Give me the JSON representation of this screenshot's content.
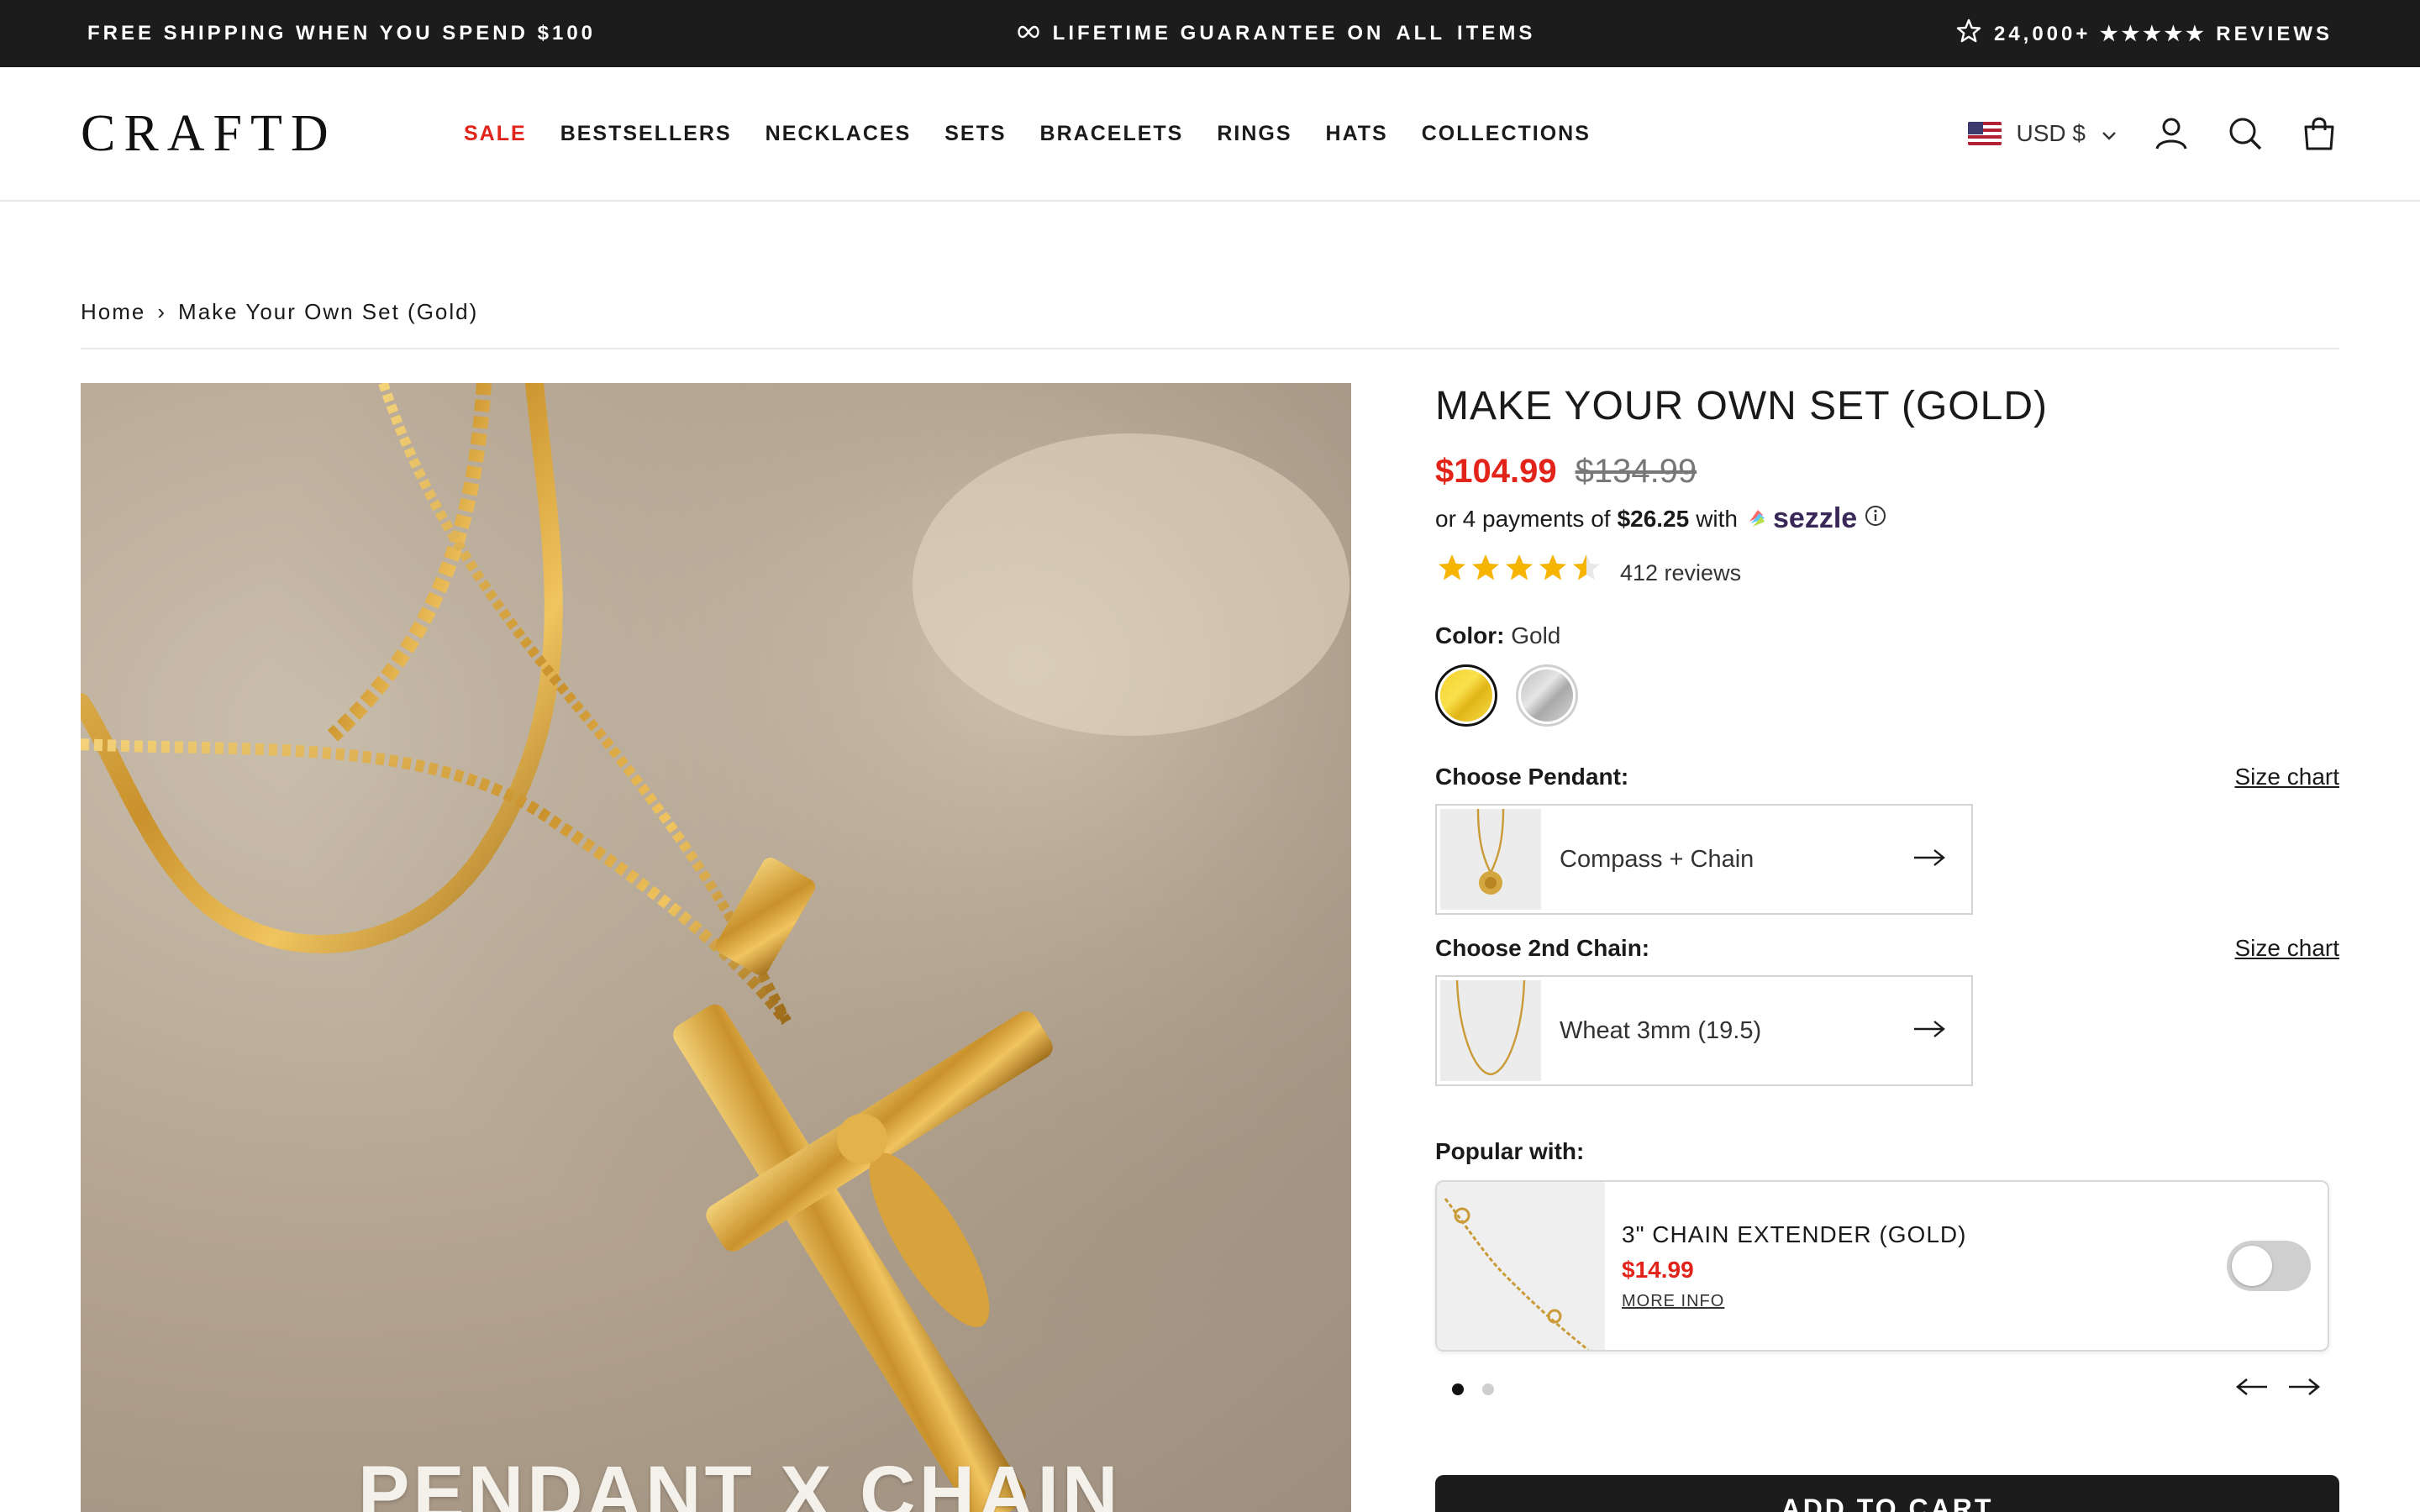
{
  "announcement": {
    "left": "FREE SHIPPING WHEN YOU SPEND $100",
    "middle_prefix": "LIFETIME GUARANTEE ON",
    "middle_bold": "ALL",
    "middle_suffix": "ITEMS",
    "right": "24,000+ ★★★★★ REVIEWS"
  },
  "header": {
    "logo": "CRAFTD",
    "nav": [
      "SALE",
      "BESTSELLERS",
      "NECKLACES",
      "SETS",
      "BRACELETS",
      "RINGS",
      "HATS",
      "COLLECTIONS"
    ],
    "currency": "USD $",
    "icons": [
      "account-icon",
      "search-icon",
      "cart-icon"
    ]
  },
  "breadcrumb": {
    "home": "Home",
    "separator": "›",
    "current": "Make Your Own Set (Gold)"
  },
  "product": {
    "image_caption": "PENDANT X CHAIN",
    "title": "MAKE YOUR OWN SET (GOLD)",
    "price_sale": "$104.99",
    "price_original": "$134.99",
    "installment_prefix": "or 4 payments of",
    "installment_amount": "$26.25",
    "installment_with": "with",
    "installment_provider": "sezzle",
    "rating_stars": 4.5,
    "review_count": "412 reviews",
    "color_label": "Color:",
    "color_value": "Gold",
    "colors": [
      {
        "name": "Gold",
        "selected": true,
        "hex": "#f6cf2a"
      },
      {
        "name": "Silver",
        "selected": false,
        "hex": "#c9c9c9"
      }
    ],
    "pendant_label": "Choose Pendant:",
    "pendant_value": "Compass + Chain",
    "chain_label": "Choose 2nd Chain:",
    "chain_value": "Wheat 3mm (19.5)",
    "size_chart": "Size chart"
  },
  "popular": {
    "label": "Popular with:",
    "item_title": "3\" CHAIN EXTENDER (GOLD)",
    "item_price": "$14.99",
    "more_info": "MORE INFO",
    "toggle_on": false,
    "page_count": 2,
    "active_page": 1
  },
  "cart": {
    "add_to_cart": "ADD TO CART"
  },
  "colors": {
    "accent_red": "#e2231a",
    "dark": "#1c1c1c",
    "star": "#f5b400"
  }
}
